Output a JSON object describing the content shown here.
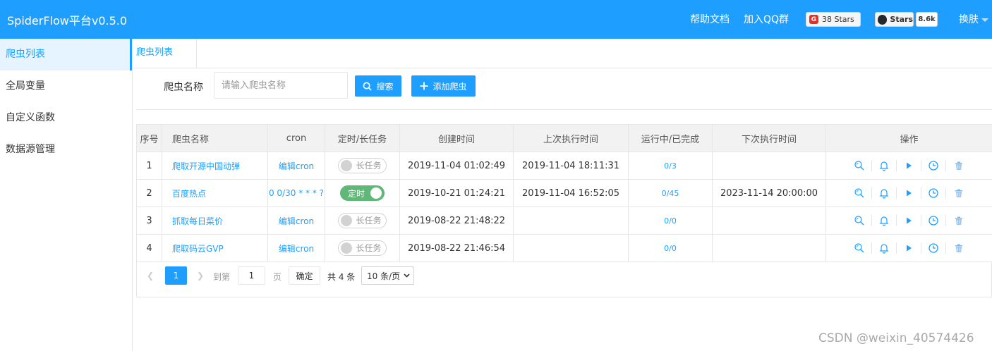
{
  "header": {
    "brand": "SpiderFlow平台v0.5.0",
    "help_docs": "帮助文档",
    "qq_group": "加入QQ群",
    "gitee_stars": "38 Stars",
    "github_label": "Stars",
    "github_count": "8.6k",
    "skin": "换肤"
  },
  "sidebar": {
    "items": [
      {
        "label": "爬虫列表"
      },
      {
        "label": "全局变量"
      },
      {
        "label": "自定义函数"
      },
      {
        "label": "数据源管理"
      }
    ]
  },
  "tab": {
    "label": "爬虫列表"
  },
  "search": {
    "label": "爬虫名称",
    "placeholder": "请输入爬虫名称",
    "search_button": "搜索",
    "add_button": "添加爬虫"
  },
  "table": {
    "headers": [
      "序号",
      "爬虫名称",
      "cron",
      "定时/长任务",
      "创建时间",
      "上次执行时间",
      "运行中/已完成",
      "下次执行时间",
      "操作"
    ],
    "rows": [
      {
        "no": "1",
        "name": "爬取开源中国动弹",
        "cron": "编辑cron",
        "toggle": "长任务",
        "created": "2019-11-04 01:02:49",
        "last": "2019-11-04 18:11:31",
        "run": "0/3",
        "next": ""
      },
      {
        "no": "2",
        "name": "百度热点",
        "cron": "0 0/30 * * * ?",
        "toggle": "定时",
        "created": "2019-10-21 01:24:21",
        "last": "2019-11-04 16:52:05",
        "run": "0/45",
        "next": "2023-11-14 20:00:00"
      },
      {
        "no": "3",
        "name": "抓取每日菜价",
        "cron": "编辑cron",
        "toggle": "长任务",
        "created": "2019-08-22 21:48:22",
        "last": "",
        "run": "0/0",
        "next": ""
      },
      {
        "no": "4",
        "name": "爬取码云GVP",
        "cron": "编辑cron",
        "toggle": "长任务",
        "created": "2019-08-22 21:46:54",
        "last": "",
        "run": "0/0",
        "next": ""
      }
    ]
  },
  "pager": {
    "current": "1",
    "goto": "到第",
    "page_value": "1",
    "page_unit": "页",
    "confirm": "确定",
    "total": "共 4 条",
    "page_size": "10 条/页"
  },
  "watermark": "CSDN @weixin_40574426",
  "colors": {
    "primary": "#1E9FFF",
    "toggle_on": "#5FB878",
    "gitee": "#e0322a"
  }
}
